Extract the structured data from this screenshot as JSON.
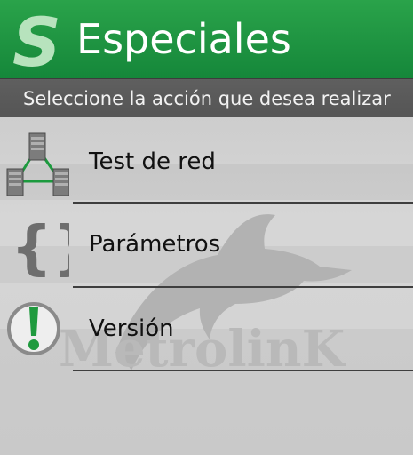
{
  "header": {
    "logo_letter": "S",
    "title": "Especiales",
    "accent_color": "#1e9a44"
  },
  "subheader": {
    "text": "Seleccione la acción que desea realizar"
  },
  "menu": {
    "items": [
      {
        "label": "Test de red",
        "icon": "network-icon"
      },
      {
        "label": "Parámetros",
        "icon": "braces-icon"
      },
      {
        "label": "Versión",
        "icon": "exclamation-icon"
      }
    ]
  },
  "watermark": {
    "text": "MetrolinK",
    "icon": "dolphin-icon"
  }
}
